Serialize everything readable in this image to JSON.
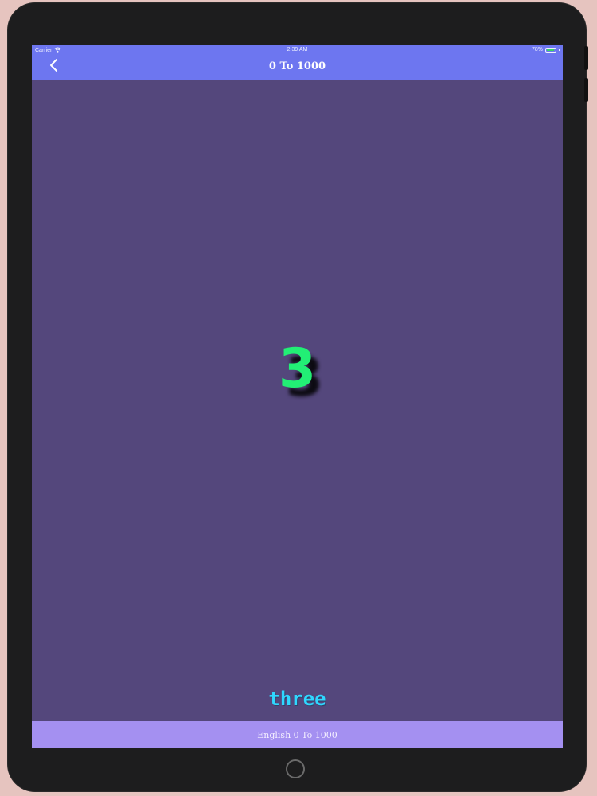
{
  "status_bar": {
    "carrier": "Carrier",
    "time": "2:39 AM",
    "battery": "78%"
  },
  "nav": {
    "title": "0 To 1000",
    "back_icon": "chevron-left-icon"
  },
  "content": {
    "number": "3",
    "word": "three"
  },
  "footer": {
    "label": "English 0 To 1000"
  },
  "colors": {
    "nav_bar": "#6d76f0",
    "background": "#54477c",
    "number": "#22ef75",
    "word": "#2fd7ff",
    "footer": "#a490f1"
  }
}
